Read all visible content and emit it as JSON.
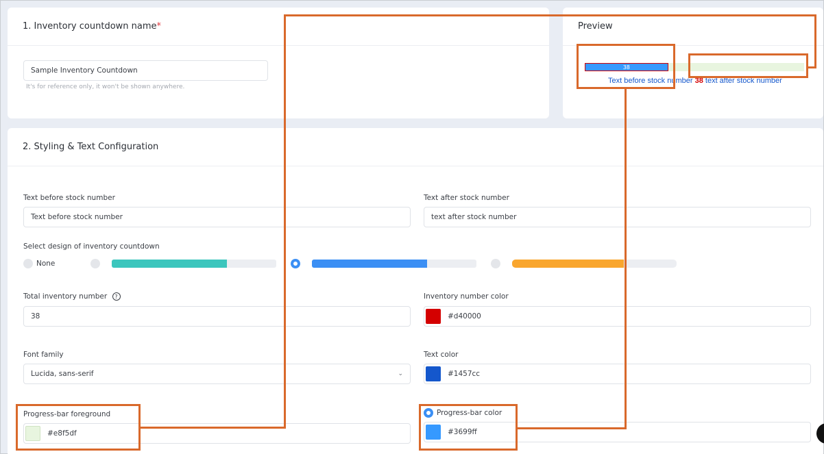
{
  "section1": {
    "title": "1. Inventory countdown name",
    "required_mark": "*",
    "name_value": "Sample Inventory Countdown",
    "hint": "It's for reference only, it won't be shown anywhere."
  },
  "preview": {
    "title": "Preview",
    "bar_number": "38",
    "text_before": "Text before stock number",
    "stock_number": "38",
    "text_after": "text after stock number",
    "fill_fraction": 0.38,
    "bar_fill_color": "#3699ff",
    "bar_track_color": "#e8f5df",
    "number_color": "#d40000",
    "text_color": "#1457cc"
  },
  "section2": {
    "title": "2. Styling & Text Configuration",
    "text_before_label": "Text before stock number",
    "text_before_value": "Text before stock number",
    "text_after_label": "Text after stock number",
    "text_after_value": "text after stock number",
    "design_label": "Select design of inventory countdown",
    "design_none_label": "None",
    "designs": [
      {
        "color": "#3cc6bd",
        "fill": 0.7
      },
      {
        "color": "#3b8ff4",
        "fill": 0.7
      },
      {
        "color": "#f9a62e",
        "fill": 0.68
      }
    ],
    "total_label": "Total inventory number",
    "help_glyph": "?",
    "total_value": "38",
    "number_color_label": "Inventory number color",
    "number_color_value": "#d40000",
    "font_label": "Font family",
    "font_value": "Lucida, sans-serif",
    "chevron_glyph": "⌄",
    "text_color_label": "Text color",
    "text_color_value": "#1457cc",
    "fg_label": "Progress-bar foreground",
    "fg_value": "#e8f5df",
    "bar_color_label": "Progress-bar color",
    "bar_color_value": "#3699ff"
  },
  "colors": {
    "callout": "#d9692b",
    "accent": "#3b8ff4"
  }
}
